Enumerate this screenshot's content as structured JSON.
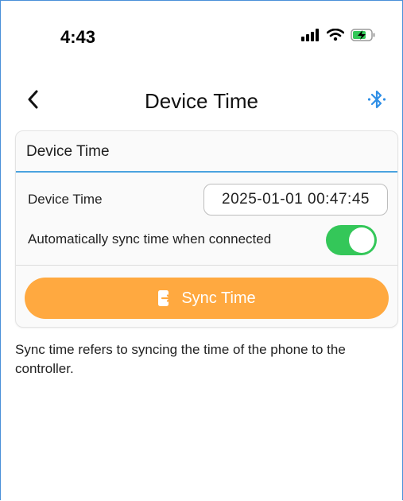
{
  "status_bar": {
    "time": "4:43"
  },
  "nav": {
    "title": "Device Time",
    "back_icon": "chevron-left-icon",
    "right_icon": "bluetooth-icon"
  },
  "card": {
    "title": "Device Time",
    "device_time_label": "Device Time",
    "device_time_value": "2025-01-01 00:47:45",
    "auto_sync_label": "Automatically sync time when connected",
    "auto_sync_enabled": true,
    "sync_button_label": "Sync Time",
    "sync_button_icon": "sync-phone-icon"
  },
  "note": "Sync time refers to syncing the time of the phone to the controller.",
  "colors": {
    "accent_blue": "#4aa3df",
    "toggle_on": "#34c759",
    "sync_button": "#ffa940",
    "bluetooth": "#2f8fe6"
  }
}
